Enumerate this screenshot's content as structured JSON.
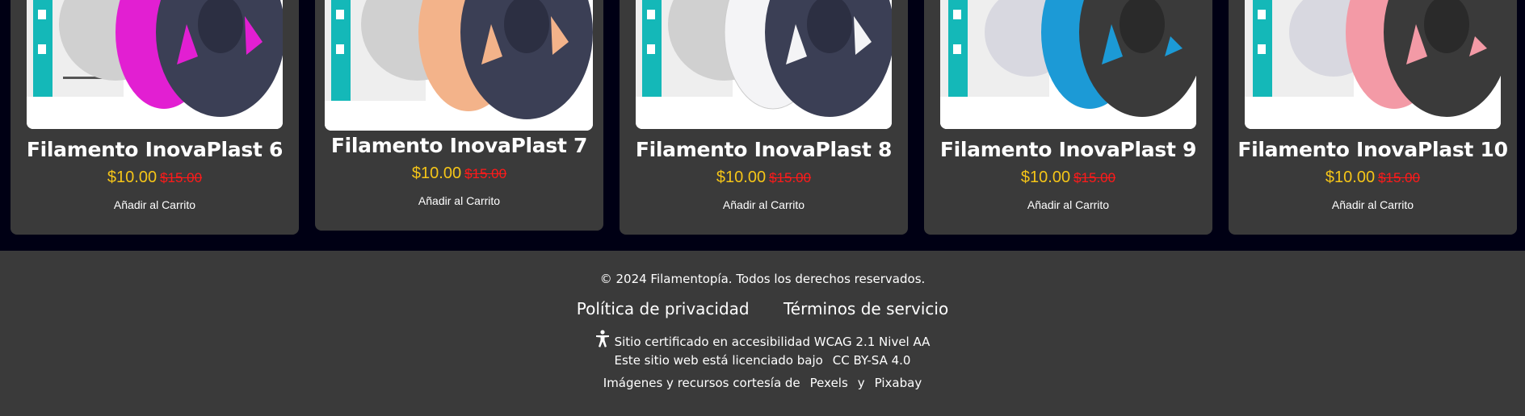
{
  "products": [
    {
      "title": "Filamento InovaPlast 6",
      "price": "$10.00",
      "old_price": "$15.00",
      "cart_label": "Añadir al Carrito",
      "spool_color": "#e21fd2"
    },
    {
      "title": "Filamento InovaPlast 7",
      "price": "$10.00",
      "old_price": "$15.00",
      "cart_label": "Añadir al Carrito",
      "spool_color": "#f3b38a"
    },
    {
      "title": "Filamento InovaPlast 8",
      "price": "$10.00",
      "old_price": "$15.00",
      "cart_label": "Añadir al Carrito",
      "spool_color": "#f4f4f6"
    },
    {
      "title": "Filamento InovaPlast 9",
      "price": "$10.00",
      "old_price": "$15.00",
      "cart_label": "Añadir al Carrito",
      "spool_color": "#1c9ad6"
    },
    {
      "title": "Filamento InovaPlast 10",
      "price": "$10.00",
      "old_price": "$15.00",
      "cart_label": "Añadir al Carrito",
      "spool_color": "#f39aa6"
    }
  ],
  "footer": {
    "copyright": "© 2024 Filamentopía. Todos los derechos reservados.",
    "privacy_label": "Política de privacidad",
    "terms_label": "Términos de servicio",
    "accessibility_text": "Sitio certificado en accesibilidad WCAG 2.1 Nivel AA",
    "license_prefix": "Este sitio web está licenciado bajo",
    "license_link": "CC BY-SA 4.0",
    "credits_prefix": "Imágenes y recursos cortesía de",
    "credits_link1": "Pexels",
    "credits_and": "y",
    "credits_link2": "Pixabay"
  },
  "colors": {
    "page_background": "#000014",
    "card_background": "#3a3a3a",
    "price_color": "#f5c518",
    "old_price_color": "#ff1a1a",
    "box_teal": "#14b8b8",
    "spool_dark": "#3b3f55"
  }
}
